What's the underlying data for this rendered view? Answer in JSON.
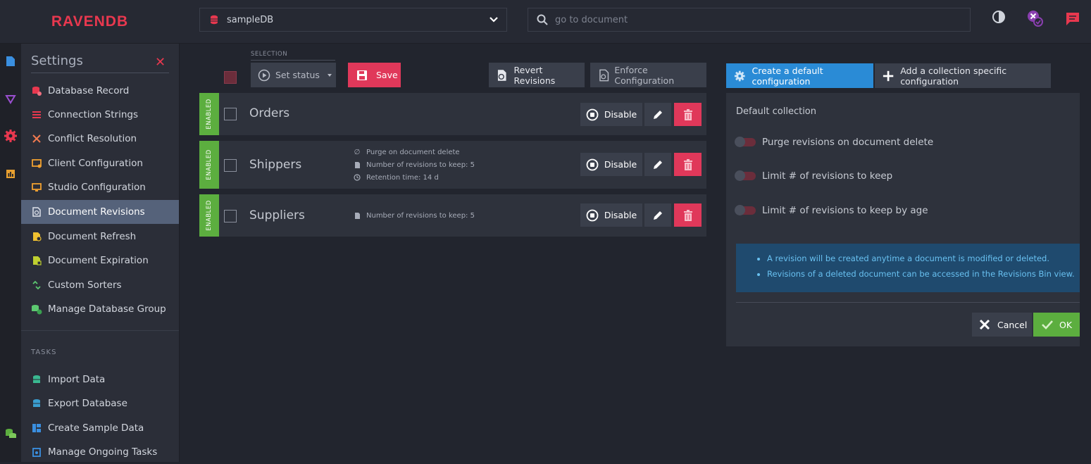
{
  "brand": {
    "logo_text": "RAVENDB",
    "accent": "#e8384f"
  },
  "header": {
    "database": "sampleDB",
    "search_placeholder": "go to document",
    "icons": [
      "contrast-icon",
      "notification-status-icon",
      "feedback-icon"
    ]
  },
  "rail": {
    "icons": [
      "documents-icon",
      "indexes-icon",
      "settings-icon",
      "stats-icon",
      "database-group-icon"
    ]
  },
  "sidebar": {
    "title": "Settings",
    "items": [
      {
        "label": "Database Record",
        "icon": "database-record-icon"
      },
      {
        "label": "Connection Strings",
        "icon": "connection-strings-icon"
      },
      {
        "label": "Conflict Resolution",
        "icon": "conflict-icon"
      },
      {
        "label": "Client Configuration",
        "icon": "client-config-icon"
      },
      {
        "label": "Studio Configuration",
        "icon": "studio-config-icon"
      },
      {
        "label": "Document Revisions",
        "icon": "revisions-icon",
        "active": true
      },
      {
        "label": "Document Refresh",
        "icon": "refresh-icon"
      },
      {
        "label": "Document Expiration",
        "icon": "expiration-icon"
      },
      {
        "label": "Custom Sorters",
        "icon": "sorters-icon"
      },
      {
        "label": "Manage Database Group",
        "icon": "db-group-icon"
      }
    ],
    "tasks_heading": "TASKS",
    "tasks": [
      {
        "label": "Import Data",
        "icon": "import-icon"
      },
      {
        "label": "Export Database",
        "icon": "export-icon"
      },
      {
        "label": "Create Sample Data",
        "icon": "sample-data-icon"
      },
      {
        "label": "Manage Ongoing Tasks",
        "icon": "ongoing-tasks-icon"
      }
    ]
  },
  "toolbar": {
    "selection_label": "SELECTION",
    "set_status_label": "Set status",
    "save_label": "Save",
    "revert_label": "Revert Revisions",
    "enforce_label": "Enforce Configuration",
    "create_default_label": "Create a default configuration",
    "add_collection_label": "Add a collection specific configuration"
  },
  "collections": [
    {
      "status": "ENABLED",
      "name": "Orders",
      "details": [],
      "disable_label": "Disable"
    },
    {
      "status": "ENABLED",
      "name": "Shippers",
      "details": [
        "Purge on document delete",
        "Number of revisions to keep: 5",
        "Retention time: 14 d"
      ],
      "disable_label": "Disable"
    },
    {
      "status": "ENABLED",
      "name": "Suppliers",
      "details": [
        "Number of revisions to keep: 5"
      ],
      "disable_label": "Disable"
    }
  ],
  "panel": {
    "title": "Default collection",
    "options": [
      "Purge revisions on document delete",
      "Limit # of revisions to keep",
      "Limit # of revisions to keep by age"
    ],
    "notes": [
      "A revision will be created anytime a document is modified or deleted.",
      "Revisions of a deleted document can be accessed in the Revisions Bin view."
    ],
    "cancel_label": "Cancel",
    "ok_label": "OK"
  }
}
